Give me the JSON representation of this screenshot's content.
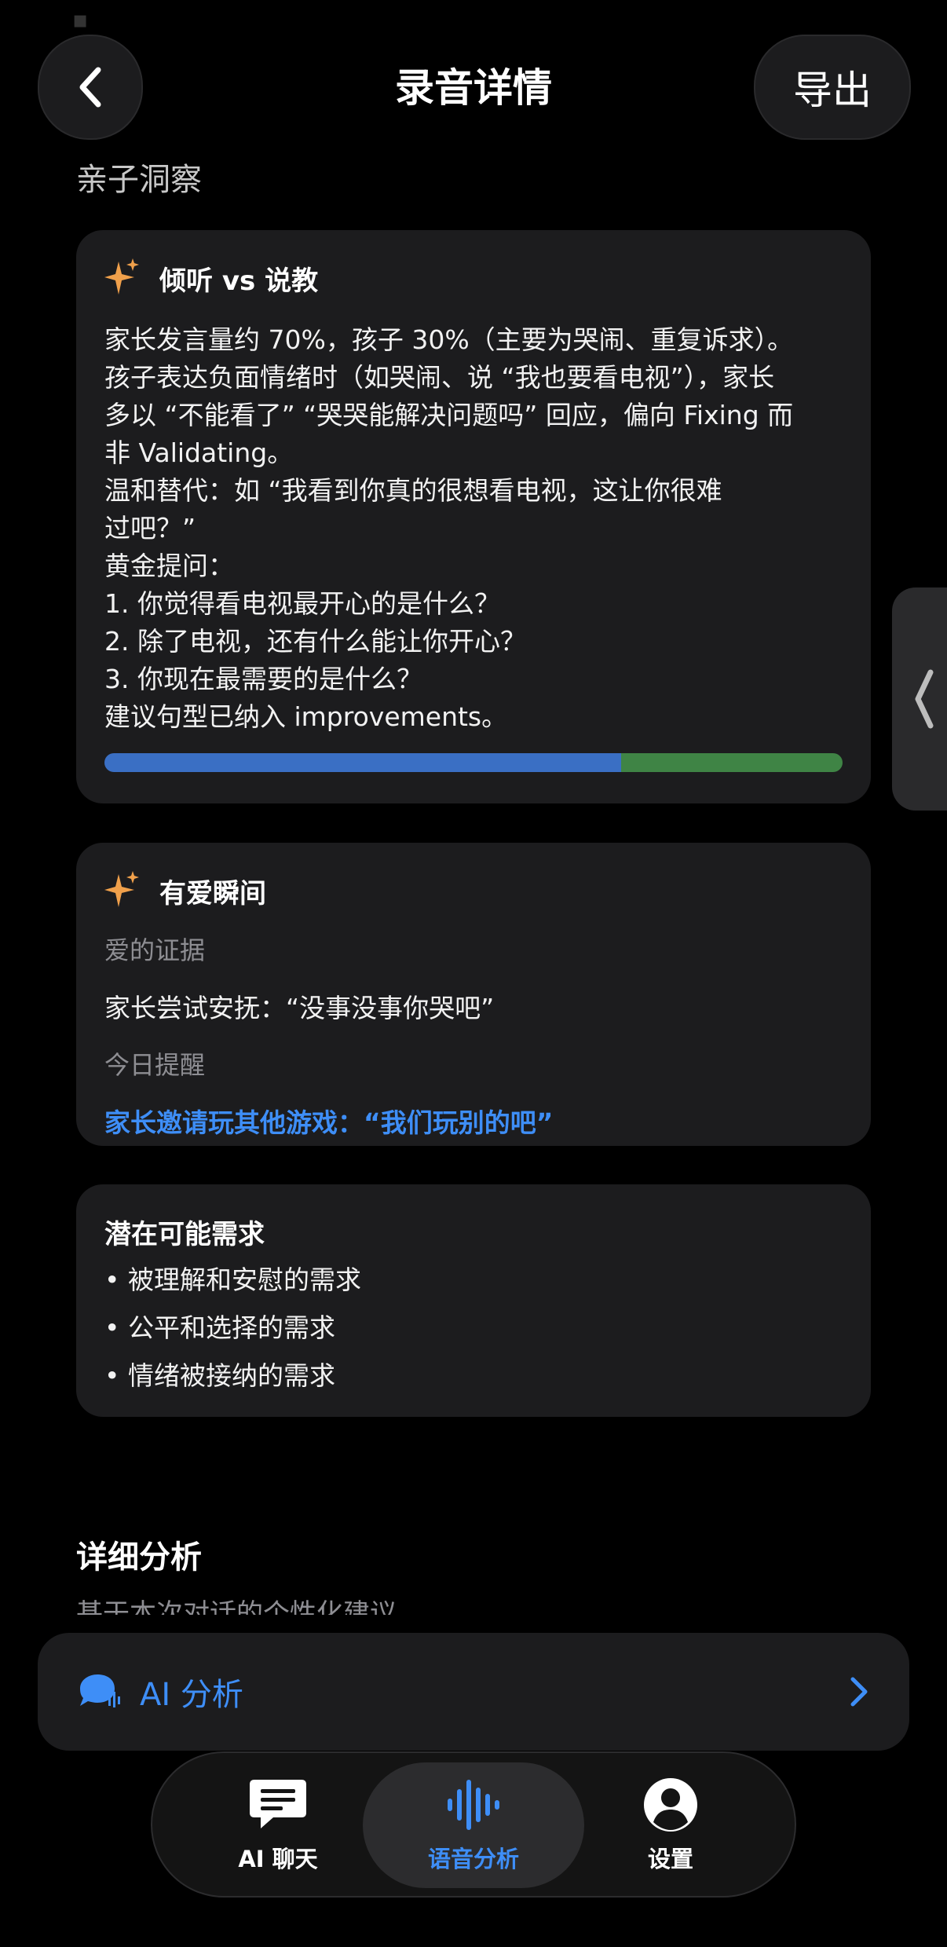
{
  "header": {
    "title": "录音详情",
    "export_label": "导出"
  },
  "section_parent_child": "亲子洞察",
  "listening_card": {
    "title": "倾听 vs 说教",
    "lines": [
      "家长发言量约 70%，孩子 30%（主要为哭闹、重复诉求）。",
      "孩子表达负面情绪时（如哭闹、说 “我也要看电视”），家长",
      "多以 “不能看了” “哭哭能解决问题吗” 回应，偏向 Fixing 而",
      "非 Validating。",
      "温和替代：如 “我看到你真的很想看电视，这让你很难",
      "过吧？”",
      "黄金提问：",
      "1. 你觉得看电视最开心的是什么？",
      "2. 除了电视，还有什么能让你开心？",
      "3. 你现在最需要的是什么？",
      "建议句型已纳入 improvements。"
    ],
    "parent_share": 0.7,
    "child_share": 0.3,
    "colors": {
      "parent": "#3a6fc4",
      "child": "#3f8445"
    }
  },
  "love_card": {
    "title": "有爱瞬间",
    "evidence_label": "爱的证据",
    "evidence_text": "家长尝试安抚：“没事没事你哭吧”",
    "reminder_label": "今日提醒",
    "reminder_text": "家长邀请玩其他游戏：“我们玩别的吧”"
  },
  "needs_card": {
    "title": "潜在可能需求",
    "items": [
      "• 被理解和安慰的需求",
      "• 公平和选择的需求",
      "• 情绪被接纳的需求"
    ]
  },
  "detail_section": {
    "title": "详细分析",
    "subtitle": "基于本次对话的个性化建议"
  },
  "ai_bar": {
    "label": "AI 分析",
    "accent": "#3e8ef7"
  },
  "tabbar": {
    "tabs": [
      {
        "label": "AI 聊天",
        "icon": "chat-bubble-icon",
        "active": false
      },
      {
        "label": "语音分析",
        "icon": "waveform-icon",
        "active": true
      },
      {
        "label": "设置",
        "icon": "person-icon",
        "active": false
      }
    ]
  }
}
